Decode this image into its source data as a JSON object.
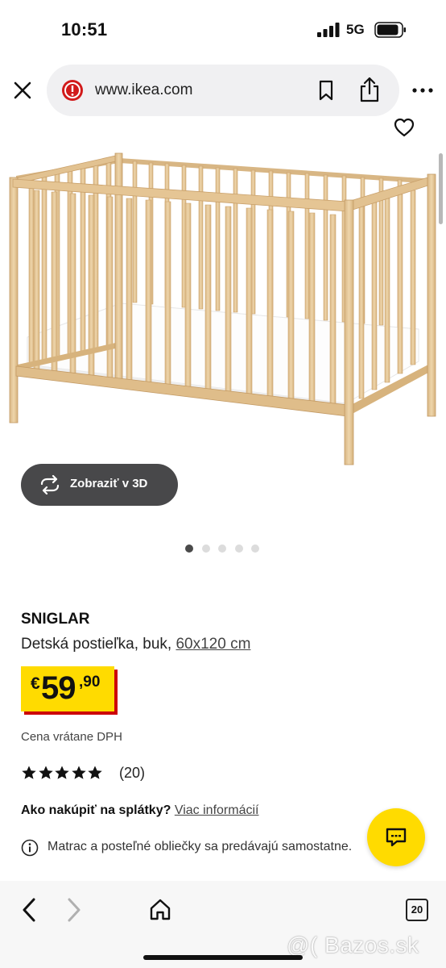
{
  "status_bar": {
    "time": "10:51",
    "network": "5G"
  },
  "browser": {
    "url": "www.ikea.com"
  },
  "product": {
    "view_3d_label": "Zobraziť v 3D",
    "carousel": {
      "count": 5,
      "active_index": 0
    },
    "name": "SNIGLAR",
    "description": "Detská postieľka, buk, ",
    "size": "60x120 cm",
    "price": {
      "currency": "€",
      "integer": "59",
      "decimal": ",90"
    },
    "vat_note": "Cena vrátane DPH",
    "rating": {
      "stars": 5,
      "count_label": "(20)"
    },
    "installment": {
      "question": "Ako nakúpiť na splátky?",
      "link": "Viac informácií"
    },
    "info_note": "Matrac a posteľné obliečky sa predávajú samostatne."
  },
  "toolbar": {
    "tabs_count": "20"
  },
  "watermark": "@( Bazos.sk",
  "colors": {
    "price_yellow": "#ffdb00",
    "price_red": "#cc0008",
    "button_dark": "#48484a",
    "wood": "#e4c79a"
  }
}
